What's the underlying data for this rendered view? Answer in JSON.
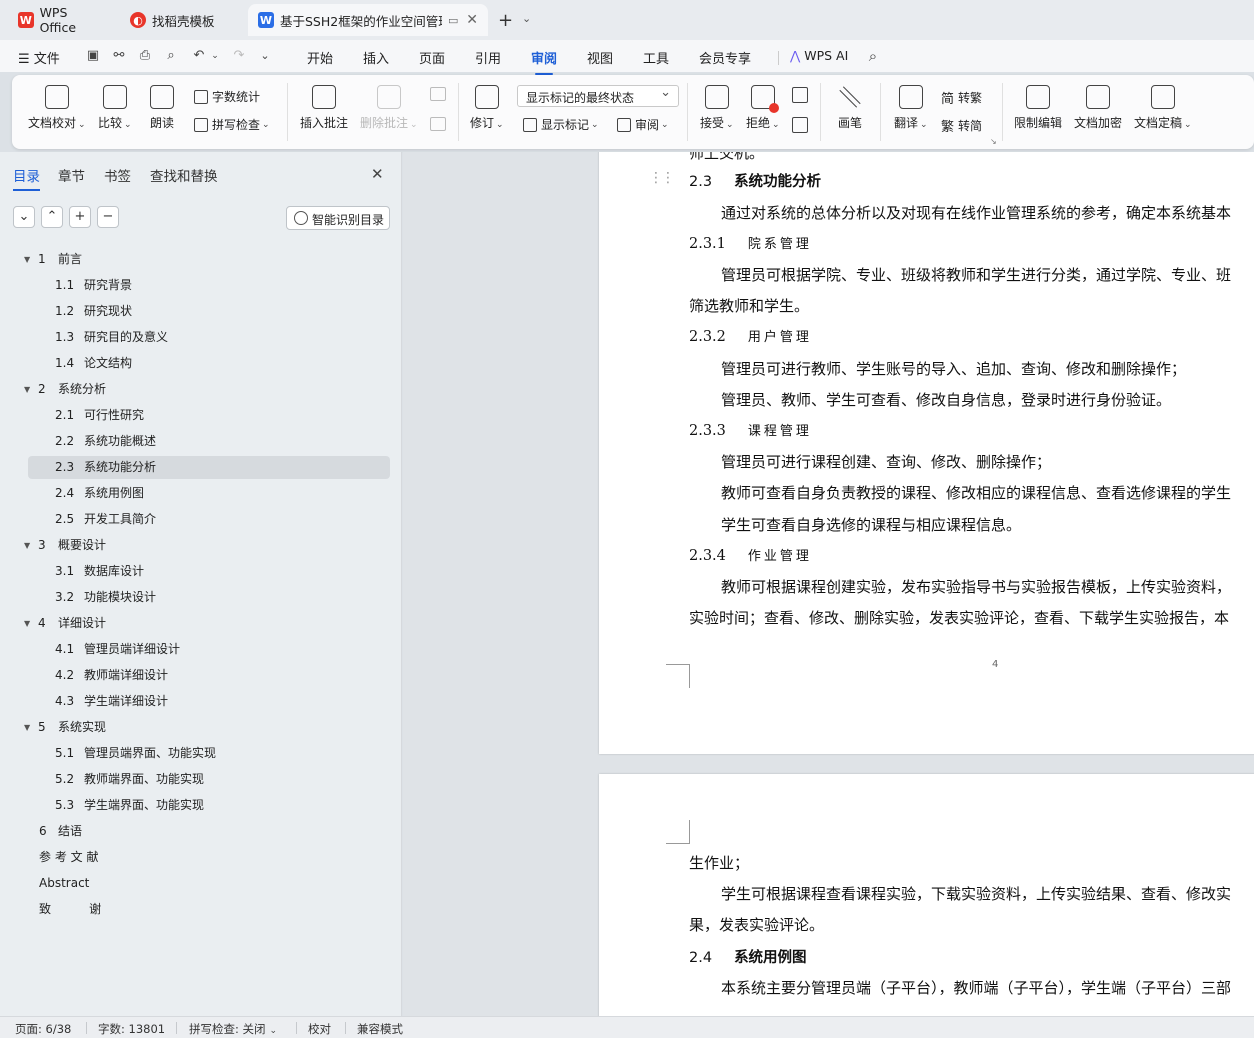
{
  "tabs": [
    {
      "label": "WPS Office"
    },
    {
      "label": "找稻壳模板"
    },
    {
      "label": "基于SSH2框架的作业空间管理"
    }
  ],
  "menu": {
    "file": "文件",
    "items": [
      "开始",
      "插入",
      "页面",
      "引用",
      "审阅",
      "视图",
      "工具",
      "会员专享"
    ],
    "active": "审阅",
    "ai": "WPS AI"
  },
  "ribbon": {
    "doc_check": "文档校对",
    "compare": "比较",
    "read_aloud": "朗读",
    "word_count": "字数统计",
    "spell_check": "拼写检查",
    "insert_comment": "插入批注",
    "delete_comment": "删除批注",
    "revise": "修订",
    "markup_state": "显示标记的最终状态",
    "show_markup": "显示标记",
    "review": "审阅",
    "accept": "接受",
    "reject": "拒绝",
    "pen": "画笔",
    "translate": "翻译",
    "to_traditional": "转繁",
    "to_simplified": "转简",
    "restrict_edit": "限制编辑",
    "encrypt": "文档加密",
    "finalize": "文档定稿"
  },
  "nav": {
    "tabs": [
      "目录",
      "章节",
      "书签",
      "查找和替换"
    ],
    "smart_toc": "智能识别目录",
    "toc": [
      {
        "num": "1",
        "label": "前言",
        "level": 1
      },
      {
        "num": "1.1",
        "label": "研究背景",
        "level": 2
      },
      {
        "num": "1.2",
        "label": "研究现状",
        "level": 2
      },
      {
        "num": "1.3",
        "label": "研究目的及意义",
        "level": 2
      },
      {
        "num": "1.4",
        "label": "论文结构",
        "level": 2
      },
      {
        "num": "2",
        "label": "系统分析",
        "level": 1
      },
      {
        "num": "2.1",
        "label": "可行性研究",
        "level": 2
      },
      {
        "num": "2.2",
        "label": "系统功能概述",
        "level": 2
      },
      {
        "num": "2.3",
        "label": "系统功能分析",
        "level": 2
      },
      {
        "num": "2.4",
        "label": "系统用例图",
        "level": 2
      },
      {
        "num": "2.5",
        "label": "开发工具简介",
        "level": 2
      },
      {
        "num": "3",
        "label": "概要设计",
        "level": 1
      },
      {
        "num": "3.1",
        "label": "数据库设计",
        "level": 2
      },
      {
        "num": "3.2",
        "label": "功能模块设计",
        "level": 2
      },
      {
        "num": "4",
        "label": "详细设计",
        "level": 1
      },
      {
        "num": "4.1",
        "label": "管理员端详细设计",
        "level": 2
      },
      {
        "num": "4.2",
        "label": "教师端详细设计",
        "level": 2
      },
      {
        "num": "4.3",
        "label": "学生端详细设计",
        "level": 2
      },
      {
        "num": "5",
        "label": "系统实现",
        "level": 1
      },
      {
        "num": "5.1",
        "label": "管理员端界面、功能实现",
        "level": 2
      },
      {
        "num": "5.2",
        "label": "教师端界面、功能实现",
        "level": 2
      },
      {
        "num": "5.3",
        "label": "学生端界面、功能实现",
        "level": 2
      },
      {
        "num": "6",
        "label": "结语",
        "level": 0
      },
      {
        "num": "",
        "label": "参 考 文 献",
        "level": 0
      },
      {
        "num": "",
        "label": "Abstract",
        "level": 0
      },
      {
        "num": "",
        "label": "致          谢",
        "level": 0
      }
    ],
    "selected_index": 8
  },
  "doc": {
    "top_fragment": "师上交机。",
    "h_2_3": {
      "num": "2.3",
      "title": "系统功能分析"
    },
    "p_intro": "通过对系统的总体分析以及对现有在线作业管理系统的参考，确定本系统基本",
    "h_2_3_1": {
      "num": "2.3.1",
      "title": "院系管理"
    },
    "p_231_a": "管理员可根据学院、专业、班级将教师和学生进行分类，通过学院、专业、班",
    "p_231_b": "筛选教师和学生。",
    "h_2_3_2": {
      "num": "2.3.2",
      "title": "用户管理"
    },
    "p_232_a": "管理员可进行教师、学生账号的导入、追加、查询、修改和删除操作；",
    "p_232_b": "管理员、教师、学生可查看、修改自身信息，登录时进行身份验证。",
    "h_2_3_3": {
      "num": "2.3.3",
      "title": "课程管理"
    },
    "p_233_a": "管理员可进行课程创建、查询、修改、删除操作；",
    "p_233_b": "教师可查看自身负责教授的课程、修改相应的课程信息、查看选修课程的学生",
    "p_233_c": "学生可查看自身选修的课程与相应课程信息。",
    "h_2_3_4": {
      "num": "2.3.4",
      "title": "作业管理"
    },
    "p_234_a": "教师可根据课程创建实验，发布实验指导书与实验报告模板，上传实验资料，",
    "p_234_b": "实验时间；查看、修改、删除实验，发表实验评论，查看、下载学生实验报告，本",
    "page_number": "4",
    "p2_a": "生作业；",
    "p2_b": "学生可根据课程查看课程实验，下载实验资料，上传实验结果、查看、修改实",
    "p2_c": "果，发表实验评论。",
    "h_2_4": {
      "num": "2.4",
      "title": "系统用例图"
    },
    "p2_d": "本系统主要分管理员端（子平台），教师端（子平台），学生端（子平台）三部"
  },
  "status": {
    "page": "页面: 6/38",
    "words": "字数: 13801",
    "spell": "拼写检查: 关闭",
    "proof": "校对",
    "compat": "兼容模式"
  },
  "colors": {
    "accent": "#1e5fd6",
    "wps_red": "#e8352a"
  }
}
